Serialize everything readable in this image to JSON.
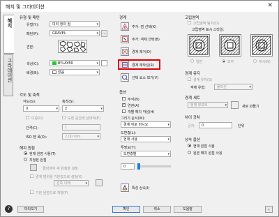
{
  "window": {
    "title": "해치 및 그라데이션",
    "close": "✕"
  },
  "tabs": [
    "해치",
    "그라데이션"
  ],
  "type_pattern": {
    "header": "유형 및 패턴",
    "type_label": "유형(Y):",
    "type_value": "미리 정의 됨",
    "pattern_label": "패턴(P):",
    "pattern_value": "GRAVEL",
    "swatch_label": "견본:",
    "color_label": "색상(C):",
    "color_value": "BYLAYER",
    "color_swatch": "#22cc22",
    "bg_label": "배경(B):",
    "bg_value": "없음"
  },
  "angle_scale": {
    "header": "각도 및 축척",
    "angle_label": "각도(G):",
    "angle_value": "0",
    "scale_label": "축척(S):",
    "scale_value": "2",
    "double_label": "이중(U)",
    "relative_label": "도면 공간에 상대적(E)",
    "spacing_label": "간격(C):",
    "spacing_value": "1",
    "iso_label": "ISO 펜 폭(O):",
    "iso_value": "2.00 mm"
  },
  "origin": {
    "header": "해치 원점",
    "current_label": "현재 원점 사용(T)",
    "specified_label": "지정된 원점",
    "click_set_label": "클릭하여 새 원점을 설정",
    "default_bound_label": "경계 범위를 기본값으로 설정(X)",
    "bottom_left_value": "왼쪽 아래",
    "store_label": "기본 원점으로 저장(F)"
  },
  "boundaries": {
    "header": "경계",
    "add_pick": "추가: 점 선택(K)",
    "add_select": "추가: 객체 선택(B)",
    "remove": "경계 제거(D)",
    "recreate": "경계 재작성(R)",
    "view_select": "선택 요소 보기(V)"
  },
  "options": {
    "header": "옵션",
    "annotative": "주석(N)",
    "associative": "연관(A)",
    "separate": "개별 해치 작성(H)",
    "draw_order_label": "그리기 순서(W):",
    "draw_order_value": "경계 뒤로 마시오",
    "layer_label": "도면층(L):",
    "layer_value": "현재 사용",
    "transparency_label": "투명도(T):",
    "transparency_value": "도면층별",
    "transparency_num": "0",
    "inherit": "특성 상속(I)"
  },
  "islands": {
    "header": "고립영역",
    "detect_label": "고립영역 탐지(D)",
    "style_label": "고립영역 표시 스타일:",
    "normal": "일반",
    "outer": "외부",
    "ignore": "무시(N)"
  },
  "boundary_retention": {
    "header": "경계 유지",
    "retain_label": "경계 유지(S)",
    "object_type_label": "객체 유형:",
    "object_type_value": "폴리선"
  },
  "boundary_set": {
    "header": "경계 세트",
    "current_viewport": "현재 뷰포트",
    "new_label": "새로 만들기"
  },
  "gap": {
    "header": "차이 공차",
    "tolerance_label": "공차:",
    "tolerance_value": "0",
    "unit": "단위"
  },
  "inherit_opts": {
    "header": "상속 옵션",
    "use_current": "현재 원점 사용",
    "use_source": "원본 해치 원점 사용"
  },
  "footer": {
    "preview": "미리보기",
    "ok": "확인",
    "cancel": "취소",
    "help": "도움말"
  }
}
